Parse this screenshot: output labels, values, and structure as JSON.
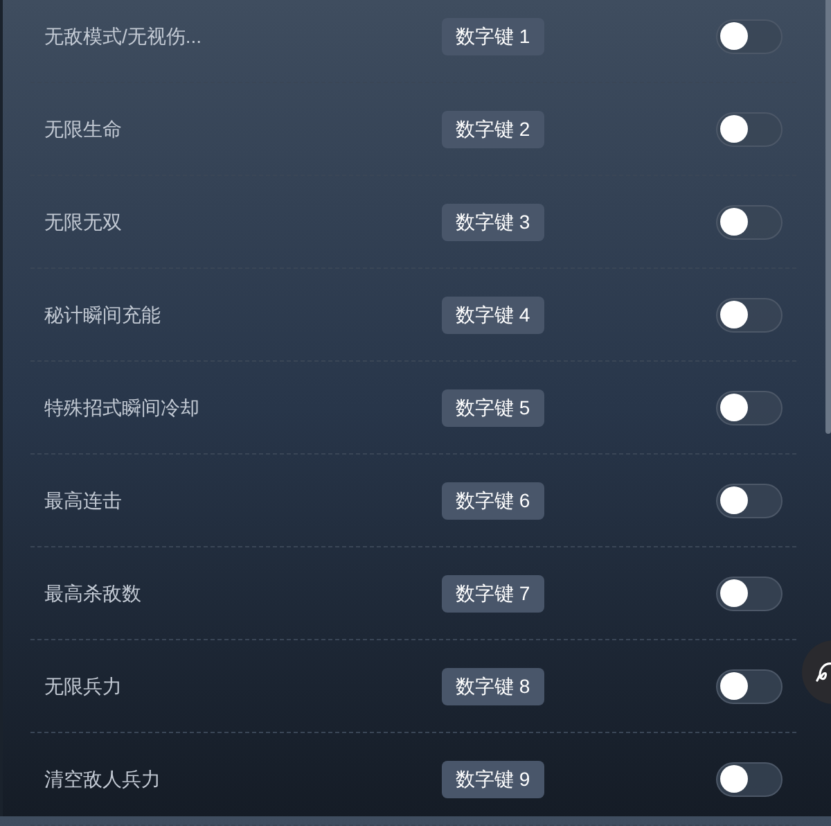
{
  "cheats": [
    {
      "name": "无敌模式/无视伤...",
      "hotkey": "数字键 1",
      "on": false
    },
    {
      "name": "无限生命",
      "hotkey": "数字键 2",
      "on": false
    },
    {
      "name": "无限无双",
      "hotkey": "数字键 3",
      "on": false
    },
    {
      "name": "秘计瞬间充能",
      "hotkey": "数字键 4",
      "on": false
    },
    {
      "name": "特殊招式瞬间冷却",
      "hotkey": "数字键 5",
      "on": false
    },
    {
      "name": "最高连击",
      "hotkey": "数字键 6",
      "on": false
    },
    {
      "name": "最高杀敌数",
      "hotkey": "数字键 7",
      "on": false
    },
    {
      "name": "无限兵力",
      "hotkey": "数字键 8",
      "on": false
    },
    {
      "name": "清空敌人兵力",
      "hotkey": "数字键 9",
      "on": false
    }
  ]
}
